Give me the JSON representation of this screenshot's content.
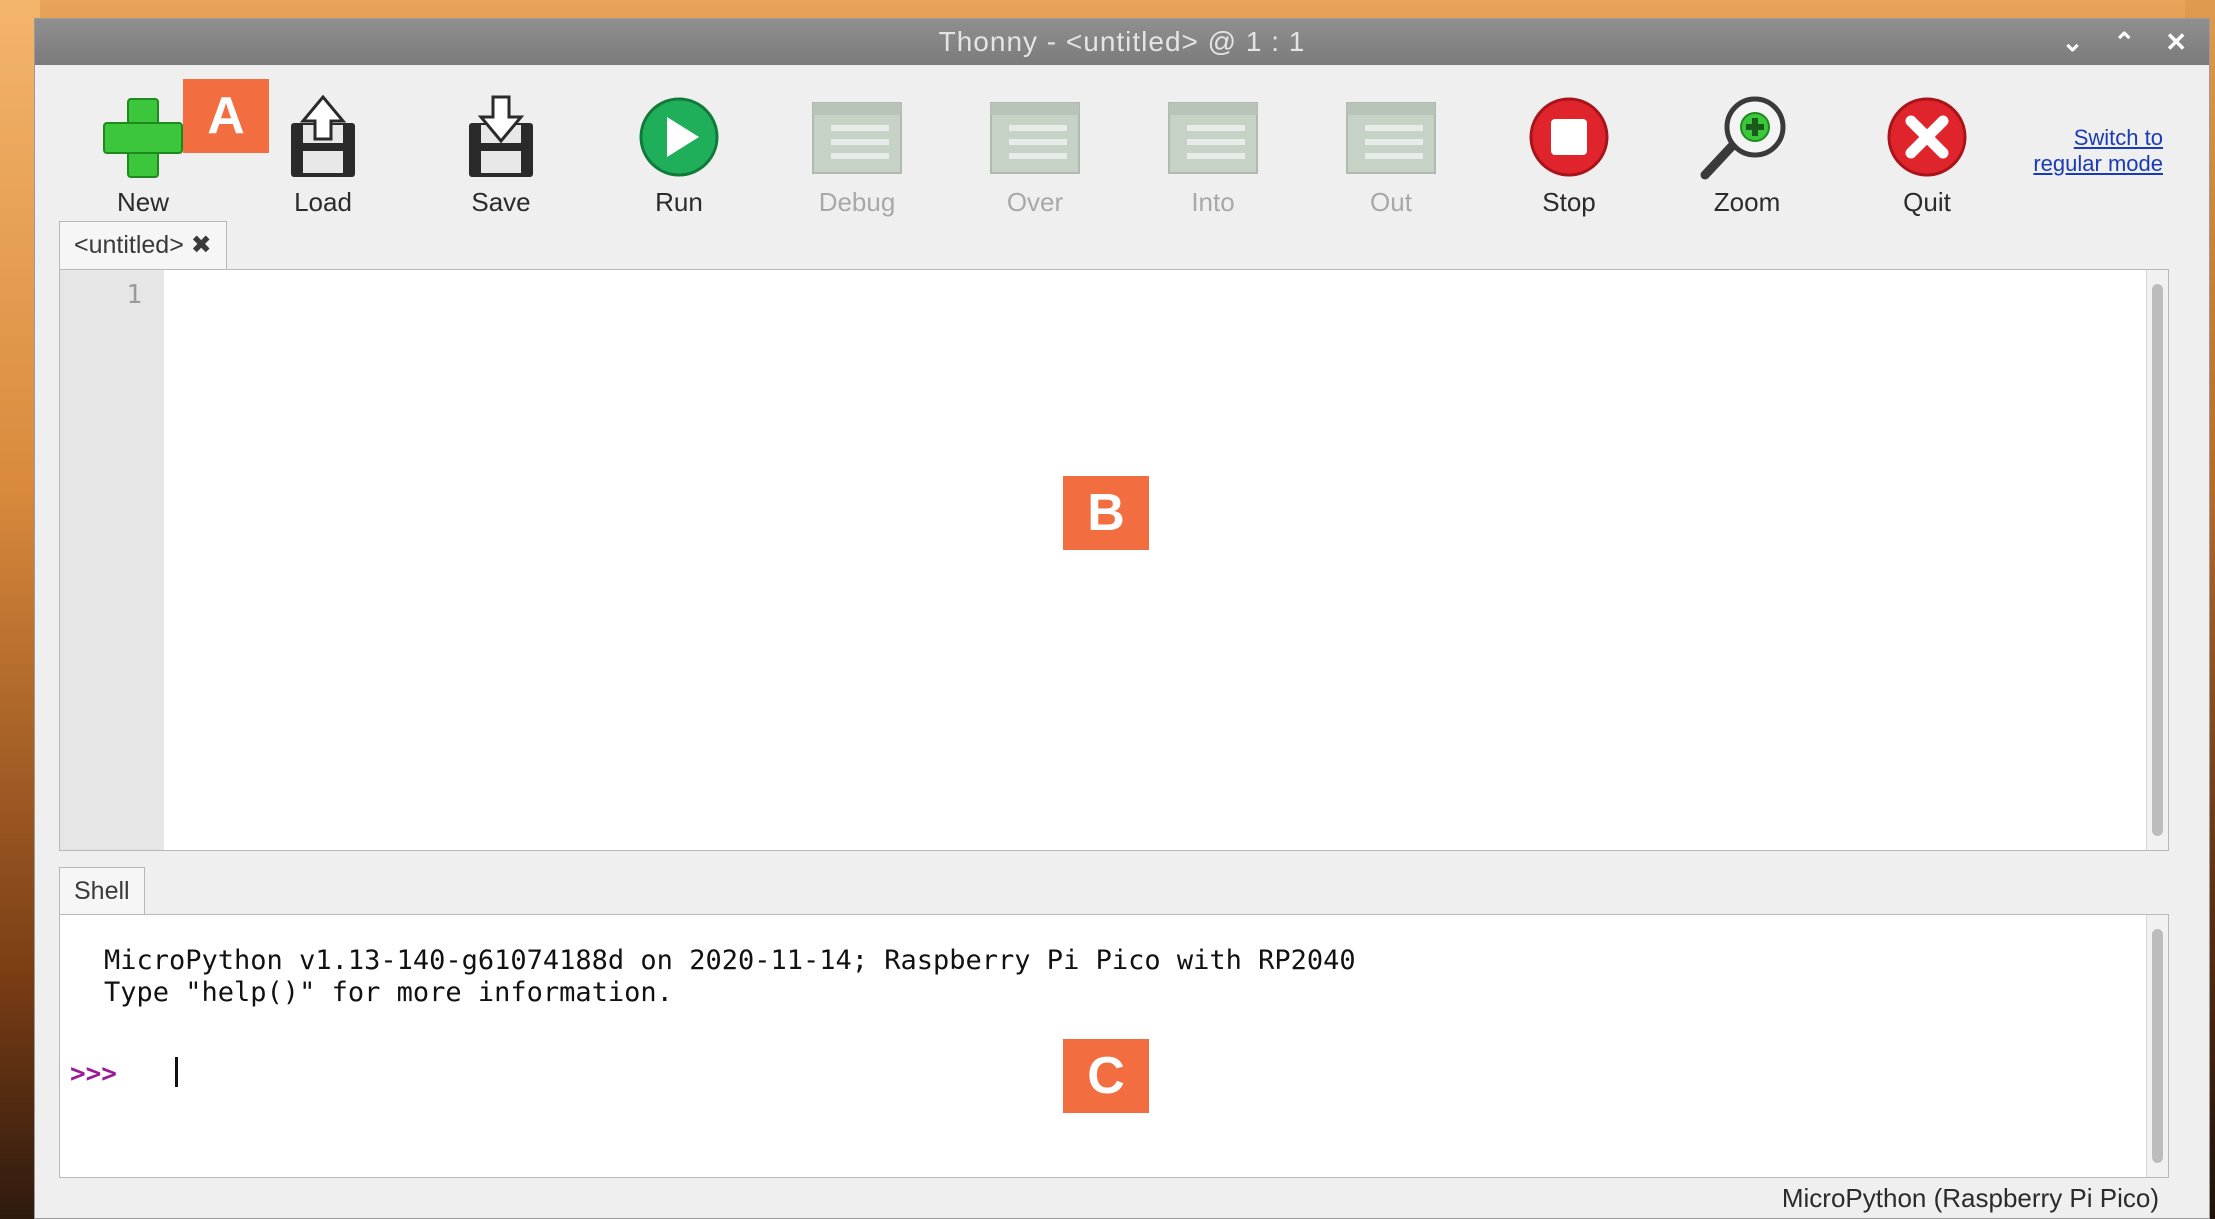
{
  "window": {
    "title": "Thonny  -  <untitled>  @  1 : 1",
    "controls": {
      "minimize": "⌄",
      "maximize": "⌃",
      "close": "✕"
    }
  },
  "toolbar": {
    "buttons": [
      {
        "label": "New",
        "icon": "plus-icon",
        "enabled": true
      },
      {
        "label": "Load",
        "icon": "load-icon",
        "enabled": true
      },
      {
        "label": "Save",
        "icon": "save-icon",
        "enabled": true
      },
      {
        "label": "Run",
        "icon": "run-icon",
        "enabled": true
      },
      {
        "label": "Debug",
        "icon": "debug-icon",
        "enabled": false
      },
      {
        "label": "Over",
        "icon": "step-over-icon",
        "enabled": false
      },
      {
        "label": "Into",
        "icon": "step-into-icon",
        "enabled": false
      },
      {
        "label": "Out",
        "icon": "step-out-icon",
        "enabled": false
      },
      {
        "label": "Stop",
        "icon": "stop-icon",
        "enabled": true
      },
      {
        "label": "Zoom",
        "icon": "zoom-icon",
        "enabled": true
      },
      {
        "label": "Quit",
        "icon": "quit-icon",
        "enabled": true
      }
    ],
    "mode_link": "Switch to regular mode"
  },
  "editor": {
    "tab_label": "<untitled> ✖",
    "line_number": "1"
  },
  "shell": {
    "tab_label": "Shell",
    "output_line1": "MicroPython v1.13-140-g61074188d on 2020-11-14; Raspberry Pi Pico with RP2040",
    "output_line2": "Type \"help()\" for more information.",
    "prompt": ">>>"
  },
  "status": {
    "interpreter": "MicroPython (Raspberry Pi Pico)"
  },
  "markers": {
    "a": "A",
    "b": "B",
    "c": "C"
  },
  "colors": {
    "marker": "#f26d3f",
    "run_green": "#1fae5a",
    "stop_red": "#e0242c",
    "new_green": "#3cc63c",
    "link_blue": "#1a3bb5",
    "prompt_purple": "#9a1a9a"
  }
}
